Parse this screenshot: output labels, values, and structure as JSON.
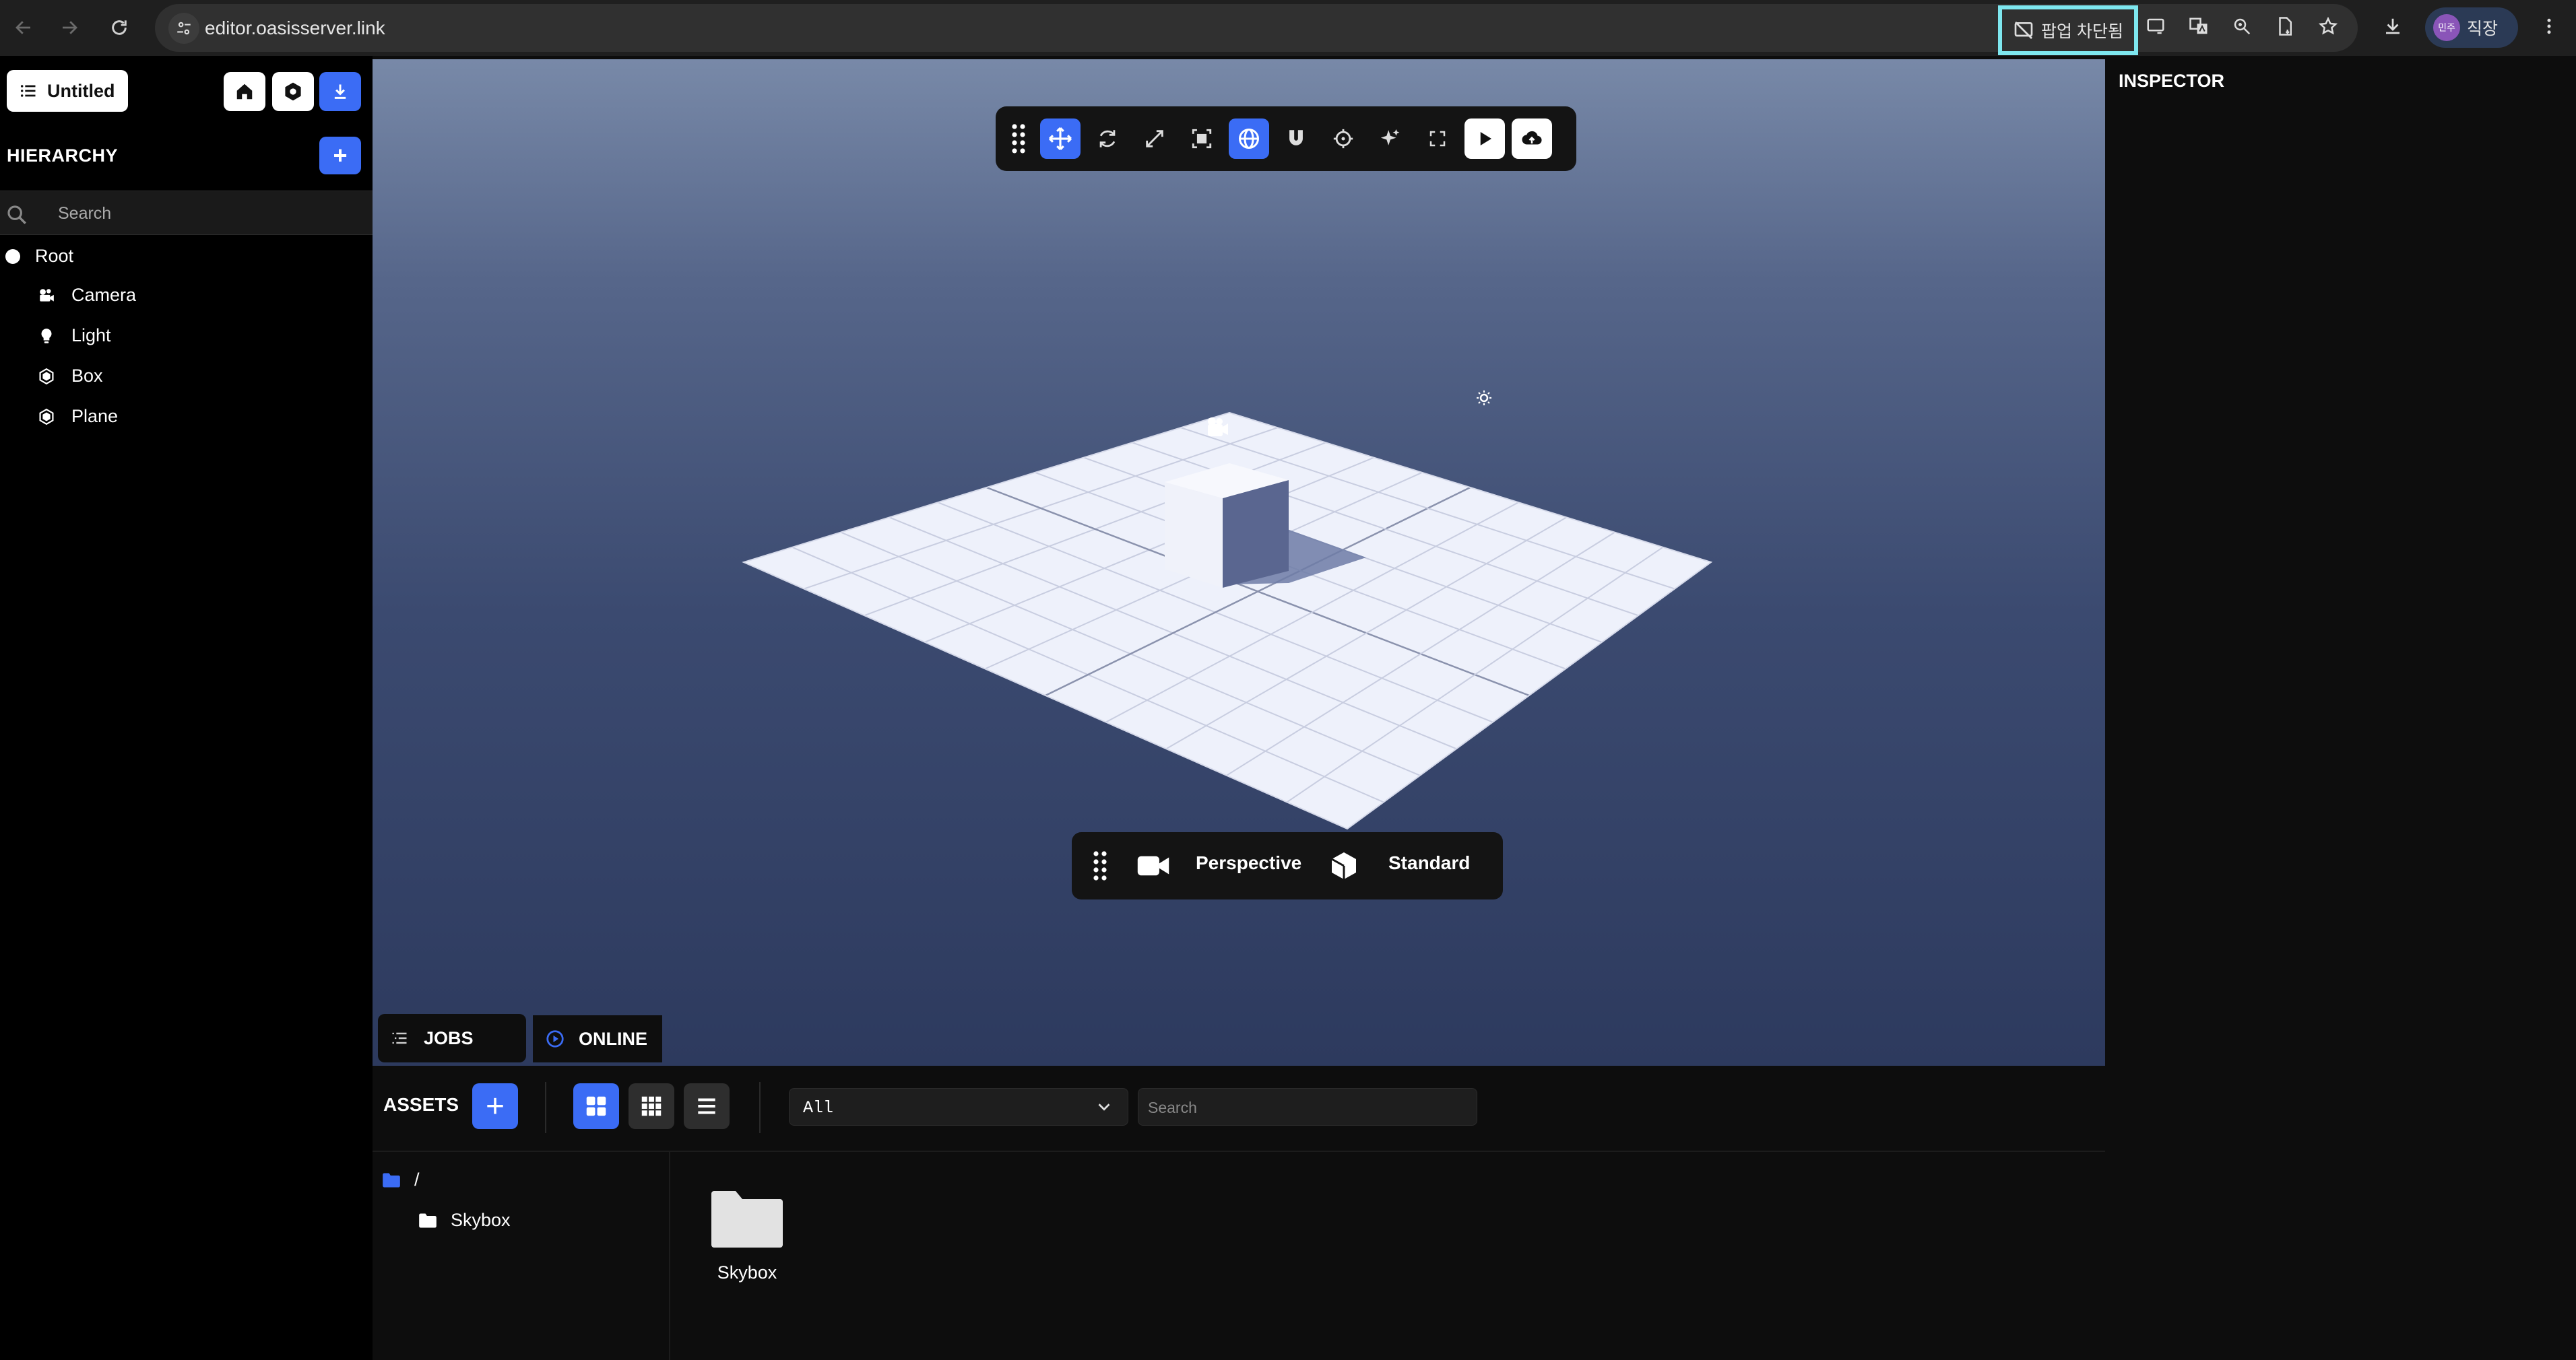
{
  "browser": {
    "url": "editor.oasisserver.link",
    "popup_blocked_label": "팝업 차단됨",
    "profile_initials": "민주",
    "profile_label": "직장"
  },
  "project": {
    "title": "Untitled"
  },
  "hierarchy": {
    "title": "HIERARCHY",
    "add_label": "+",
    "search_placeholder": "Search",
    "root": "Root",
    "items": [
      {
        "label": "Camera",
        "icon": "camera-icon"
      },
      {
        "label": "Light",
        "icon": "light-bulb-icon"
      },
      {
        "label": "Box",
        "icon": "hexagon-icon"
      },
      {
        "label": "Plane",
        "icon": "hexagon-icon"
      }
    ]
  },
  "viewport": {
    "camera_mode": "Perspective",
    "render_mode": "Standard",
    "jobs_label": "JOBS",
    "online_label": "ONLINE"
  },
  "inspector": {
    "title": "INSPECTOR"
  },
  "assets": {
    "title": "ASSETS",
    "add_label": "+",
    "type_filter": "All",
    "search_placeholder": "Search",
    "tree": {
      "root": "/",
      "folders": [
        "Skybox"
      ]
    },
    "tiles": [
      {
        "name": "Skybox",
        "type": "folder"
      }
    ]
  },
  "colors": {
    "accent": "#3b6cf5",
    "highlight": "#7ee7ef",
    "panel_bg": "#000000"
  }
}
